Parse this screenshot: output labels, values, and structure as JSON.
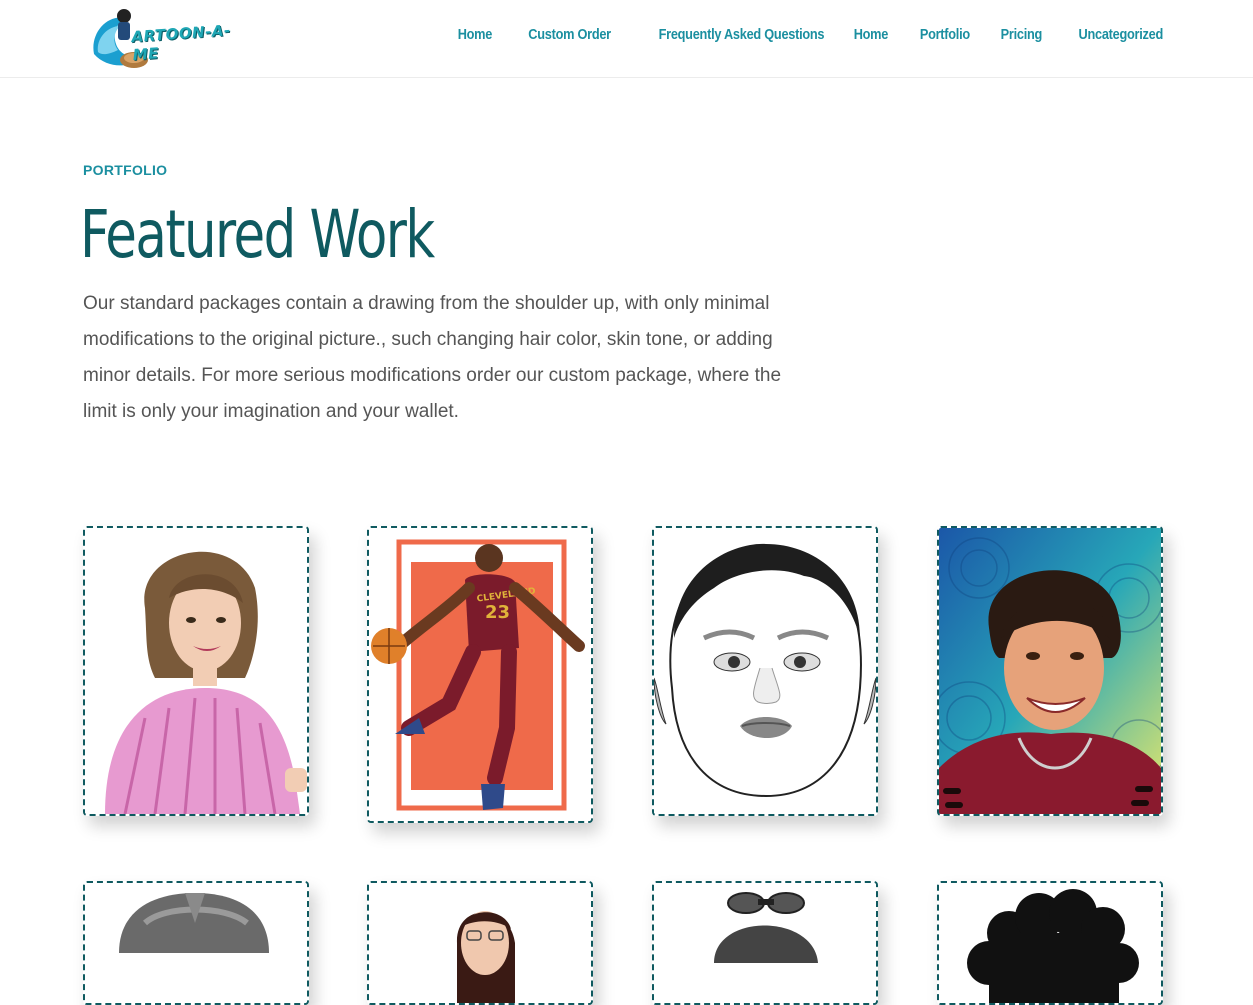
{
  "brand": {
    "logo_text": "ARTOON-A-ME",
    "accent": "#1b8fa0",
    "title_color": "#0f5a60",
    "border_color": "#0f5a60"
  },
  "nav": {
    "items": [
      {
        "label": "Home"
      },
      {
        "label": "Custom Order"
      },
      {
        "label": "Frequently Asked Questions"
      },
      {
        "label": "Home"
      },
      {
        "label": "Portfolio"
      },
      {
        "label": "Pricing"
      },
      {
        "label": "Uncategorized"
      }
    ]
  },
  "hero": {
    "eyebrow": "PORTFOLIO",
    "title": "Featured Work",
    "intro": "Our standard packages contain a drawing from the shoulder up, with only minimal modifications to the original picture., such changing hair color, skin tone, or adding minor details. For more serious modifications order our custom package, where the limit is only your imagination and your wallet."
  },
  "gallery": {
    "items": [
      {
        "icon": "woman-pink-shirt-portrait"
      },
      {
        "icon": "basketball-player-portrait",
        "jersey_text": "CLEVELAND",
        "jersey_number": "23"
      },
      {
        "icon": "baby-face-sketch"
      },
      {
        "icon": "smiling-woman-mandala-portrait"
      },
      {
        "icon": "helmet-portrait"
      },
      {
        "icon": "woman-glasses-portrait"
      },
      {
        "icon": "goggles-portrait"
      },
      {
        "icon": "curly-hair-portrait"
      }
    ]
  }
}
